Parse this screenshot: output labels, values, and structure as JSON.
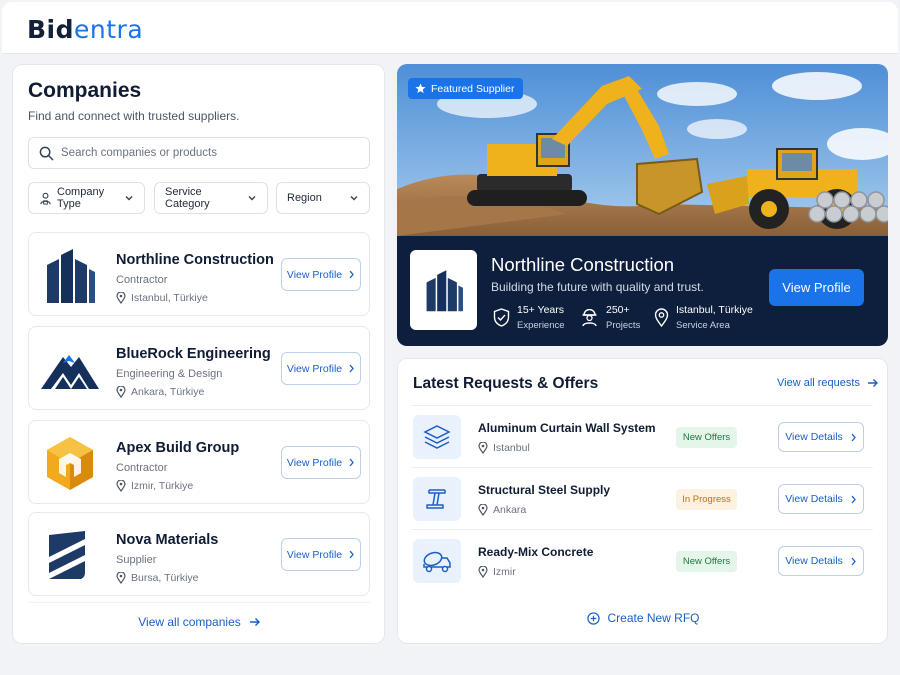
{
  "brand": {
    "part1": "Bid",
    "part2": "entra"
  },
  "companies": {
    "title": "Companies",
    "subtitle": "Find and connect with trusted suppliers.",
    "search_placeholder": "Search companies or products",
    "filters": [
      {
        "label": "Company Type",
        "icon": "user-building-icon"
      },
      {
        "label": "Service Category",
        "icon": ""
      },
      {
        "label": "Region",
        "icon": ""
      }
    ],
    "list": [
      {
        "name": "Northline Construction",
        "type": "Contractor",
        "location": "Istanbul, Türkiye",
        "button": "View Profile",
        "logo": "northline-logo"
      },
      {
        "name": "BlueRock Engineering",
        "type": "Engineering & Design",
        "location": "Ankara, Türkiye",
        "button": "View Profile",
        "logo": "bluerock-logo"
      },
      {
        "name": "Apex Build Group",
        "type": "Contractor",
        "location": "Izmir, Türkiye",
        "button": "View Profile",
        "logo": "apex-logo"
      },
      {
        "name": "Nova Materials",
        "type": "Supplier",
        "location": "Bursa, Türkiye",
        "button": "View Profile",
        "logo": "nova-logo"
      }
    ],
    "view_all": "View all companies"
  },
  "featured": {
    "badge": "Featured Supplier",
    "name": "Northline Construction",
    "tagline": "Building the future with quality and trust.",
    "stats": [
      {
        "value": "15+ Years",
        "label": "Experience",
        "icon": "shield-check-icon"
      },
      {
        "value": "250+",
        "label": "Projects",
        "icon": "workers-icon"
      },
      {
        "value": "Istanbul, Türkiye",
        "label": "Service Area",
        "icon": "location-pin-icon"
      }
    ],
    "button": "View Profile"
  },
  "requests": {
    "title": "Latest Requests & Offers",
    "view_all": "View all requests",
    "items": [
      {
        "name": "Aluminum Curtain Wall System",
        "location": "Istanbul",
        "status": "New Offers",
        "status_color": "#1e7a3d",
        "button": "View Details",
        "icon": "layers-icon"
      },
      {
        "name": "Structural Steel Supply",
        "location": "Ankara",
        "status": "In Progress",
        "status_color": "#c2710c",
        "button": "View Details",
        "icon": "steel-beam-icon"
      },
      {
        "name": "Ready-Mix Concrete",
        "location": "Izmir",
        "status": "New Offers",
        "status_color": "#1e7a3d",
        "button": "View Details",
        "icon": "concrete-mixer-icon"
      }
    ],
    "create": "Create New RFQ"
  },
  "colors": {
    "accent": "#1a73e8",
    "navy": "#0e1f3d"
  }
}
